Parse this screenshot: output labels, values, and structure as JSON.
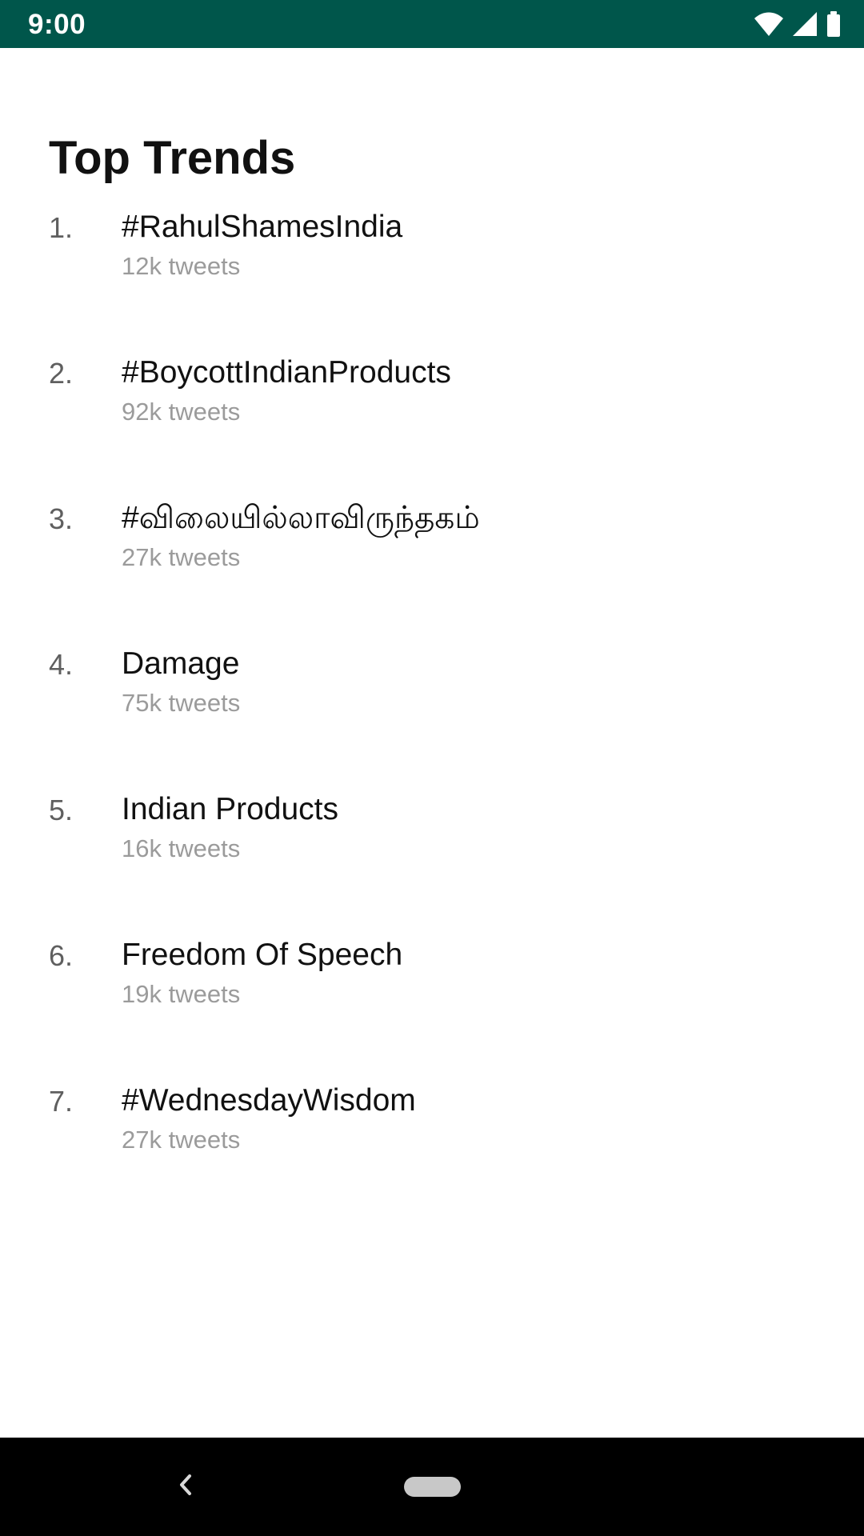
{
  "status_bar": {
    "time": "9:00",
    "icons": [
      "wifi-icon",
      "cellular-signal-icon",
      "battery-icon"
    ],
    "background_color": "#00564b"
  },
  "page": {
    "title": "Top Trends"
  },
  "trends": [
    {
      "rank": "1.",
      "name": "#RahulShamesIndia",
      "count": "12k tweets"
    },
    {
      "rank": "2.",
      "name": "#BoycottIndianProducts",
      "count": "92k tweets"
    },
    {
      "rank": "3.",
      "name": "#விலையில்லாவிருந்தகம்",
      "count": "27k tweets"
    },
    {
      "rank": "4.",
      "name": "Damage",
      "count": "75k tweets"
    },
    {
      "rank": "5.",
      "name": "Indian Products",
      "count": "16k tweets"
    },
    {
      "rank": "6.",
      "name": "Freedom Of Speech",
      "count": "19k tweets"
    },
    {
      "rank": "7.",
      "name": "#WednesdayWisdom",
      "count": "27k tweets"
    }
  ],
  "navigation_bar": {
    "icons": [
      "back-icon",
      "home-pill-icon"
    ]
  }
}
